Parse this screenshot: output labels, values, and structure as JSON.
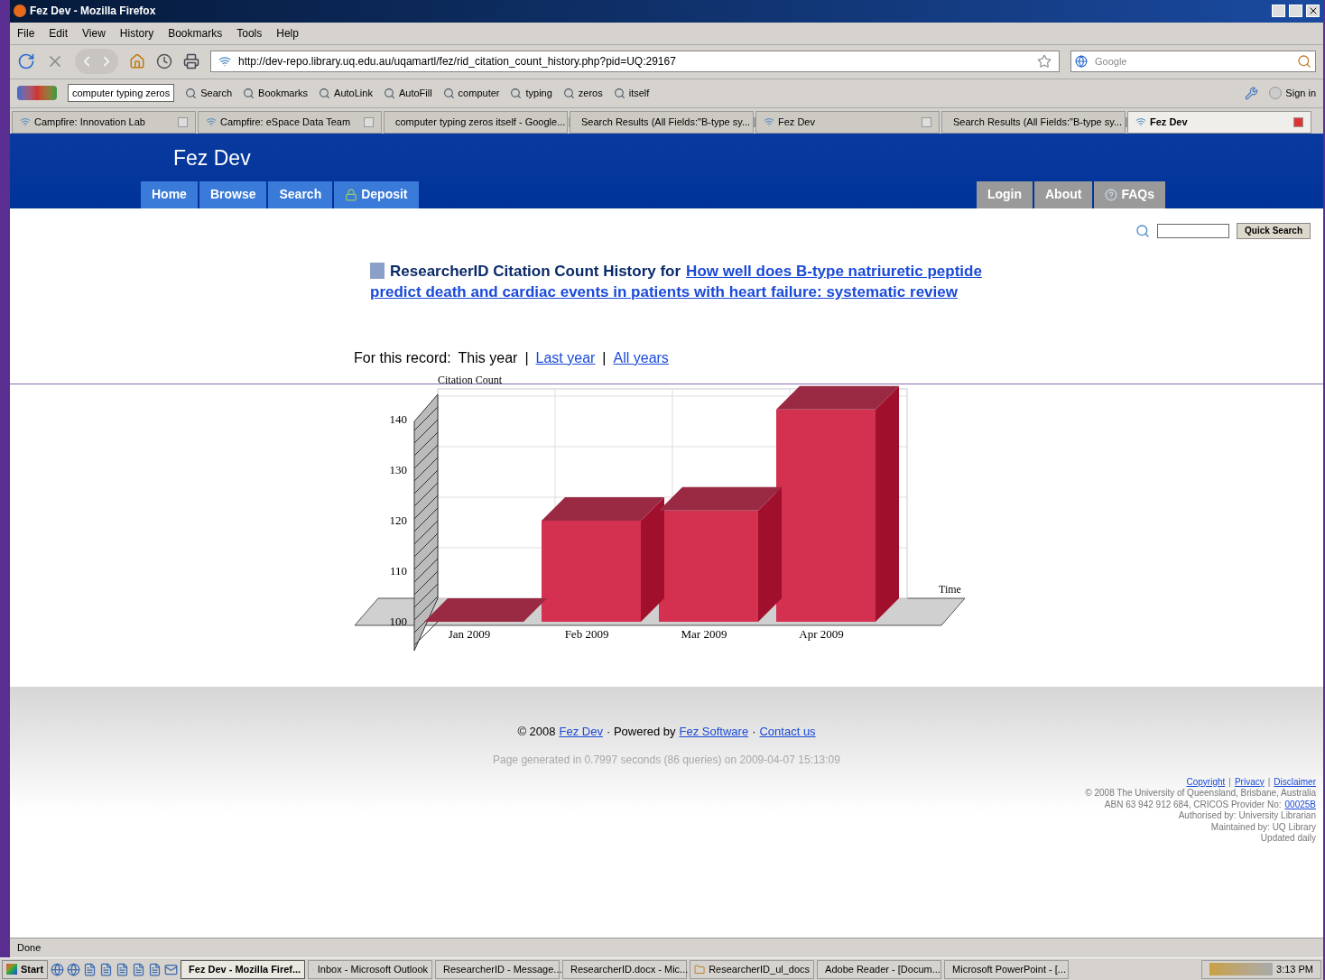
{
  "window": {
    "title": "Fez Dev - Mozilla Firefox"
  },
  "menu": [
    "File",
    "Edit",
    "View",
    "History",
    "Bookmarks",
    "Tools",
    "Help"
  ],
  "address": {
    "value": "http://dev-repo.library.uq.edu.au/uqamartl/fez/rid_citation_count_history.php?pid=UQ:29167"
  },
  "search_box": {
    "placeholder": "Google"
  },
  "google_toolbar": {
    "query": "computer typing zeros",
    "items": [
      "Search",
      "Bookmarks",
      "AutoLink",
      "AutoFill",
      "computer",
      "typing",
      "zeros",
      "itself"
    ],
    "sign_in": "Sign in"
  },
  "tabs": [
    {
      "label": "Campfire: Innovation Lab",
      "selected": false
    },
    {
      "label": "Campfire: eSpace Data Team",
      "selected": false
    },
    {
      "label": "computer typing zeros itself - Google...",
      "selected": false
    },
    {
      "label": "Search Results (All Fields:\"B-type sy...",
      "selected": false
    },
    {
      "label": "Fez Dev",
      "selected": false
    },
    {
      "label": "Search Results (All Fields:\"B-type sy...",
      "selected": false
    },
    {
      "label": "Fez Dev",
      "selected": true
    }
  ],
  "site": {
    "title": "Fez Dev",
    "nav_left": [
      "Home",
      "Browse",
      "Search",
      "Deposit"
    ],
    "nav_right": [
      "Login",
      "About",
      "FAQs"
    ],
    "quick_search": "Quick Search"
  },
  "heading": {
    "prefix": "ResearcherID Citation Count History for",
    "link_lines": [
      "How well does B-type natriuretic peptide",
      "predict death and cardiac events in patients with heart failure: systematic review"
    ]
  },
  "period": {
    "label": "For this record:",
    "separator": "|",
    "options": [
      {
        "label": "This year",
        "selected": true
      },
      {
        "label": "Last year",
        "selected": false
      },
      {
        "label": "All years",
        "selected": false
      }
    ]
  },
  "chart": {
    "chart_data": {
      "type": "bar",
      "ylabel": "Citation Count",
      "xlabel": "Time",
      "categories": [
        "Jan 2009",
        "Feb 2009",
        "Mar 2009",
        "Apr 2009"
      ],
      "values": [
        100,
        120,
        122,
        142
      ],
      "ylim": [
        100,
        145
      ],
      "yticks": [
        100,
        110,
        120,
        130,
        140
      ]
    }
  },
  "footer": {
    "year": "© 2008",
    "site_link": "Fez Dev",
    "dot": "·",
    "powered": "Powered by",
    "software_link": "Fez Software",
    "contact_link": "Contact us",
    "generated": "Page generated in 0.7997 seconds (86 queries) on 2009-04-07 15:13:09",
    "links": [
      "Copyright",
      "Privacy",
      "Disclaimer"
    ],
    "separator": "|",
    "lines": [
      "© 2008 The University of Queensland, Brisbane, Australia"
    ],
    "abn": "ABN 63 942 912 684, CRICOS Provider No:",
    "cricos": "00025B",
    "lines2": [
      "Authorised by: University Librarian",
      "Maintained by: UQ Library",
      "Updated daily"
    ]
  },
  "status_bar": "Done",
  "taskbar": {
    "start": "Start",
    "tasks": [
      {
        "label": "Fez Dev - Mozilla Firef...",
        "selected": true
      },
      {
        "label": "Inbox - Microsoft Outlook",
        "selected": false
      },
      {
        "label": "ResearcherID - Message...",
        "selected": false
      },
      {
        "label": "ResearcherID.docx - Mic...",
        "selected": false
      },
      {
        "label": "ResearcherID_ul_docs",
        "selected": false
      },
      {
        "label": "Adobe Reader - [Docum...",
        "selected": false
      },
      {
        "label": "Microsoft PowerPoint - [...",
        "selected": false
      }
    ],
    "clock": "3:13 PM"
  }
}
